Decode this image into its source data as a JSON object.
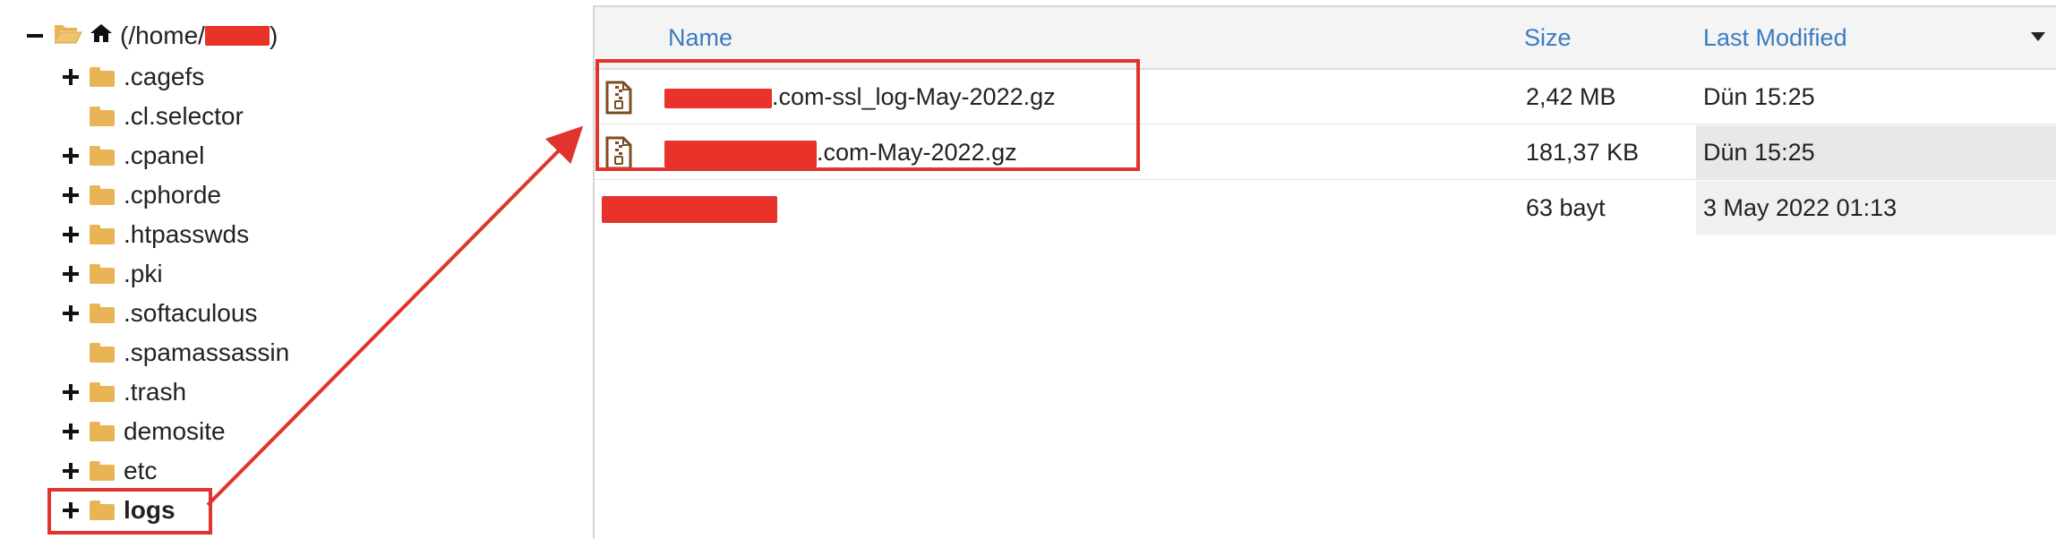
{
  "tree": {
    "root_prefix": "(/home/",
    "root_suffix": ")",
    "items": [
      {
        "label": ".cagefs",
        "expandable": true
      },
      {
        "label": ".cl.selector",
        "expandable": false
      },
      {
        "label": ".cpanel",
        "expandable": true
      },
      {
        "label": ".cphorde",
        "expandable": true
      },
      {
        "label": ".htpasswds",
        "expandable": true
      },
      {
        "label": ".pki",
        "expandable": true
      },
      {
        "label": ".softaculous",
        "expandable": true
      },
      {
        "label": ".spamassassin",
        "expandable": false
      },
      {
        "label": ".trash",
        "expandable": true
      },
      {
        "label": "demosite",
        "expandable": true
      },
      {
        "label": "etc",
        "expandable": true
      },
      {
        "label": "logs",
        "expandable": true,
        "selected": true
      }
    ]
  },
  "table": {
    "headers": {
      "name": "Name",
      "size": "Size",
      "modified": "Last Modified"
    },
    "rows": [
      {
        "name": ".com-ssl_log-May-2022.gz",
        "size": "2,42 MB",
        "modified": "Dün 15:25",
        "icon": "archive-file-icon"
      },
      {
        "name": ".com-May-2022.gz",
        "size": "181,37 KB",
        "modified": "Dün 15:25",
        "icon": "archive-file-icon"
      },
      {
        "name": "",
        "size": "63 bayt",
        "modified": "3 May 2022 01:13",
        "icon": "folder-icon"
      }
    ]
  },
  "colors": {
    "folder": "#e8b456",
    "link": "#3a7cc1",
    "annotation": "#e0342c",
    "redaction": "#e8322a"
  }
}
